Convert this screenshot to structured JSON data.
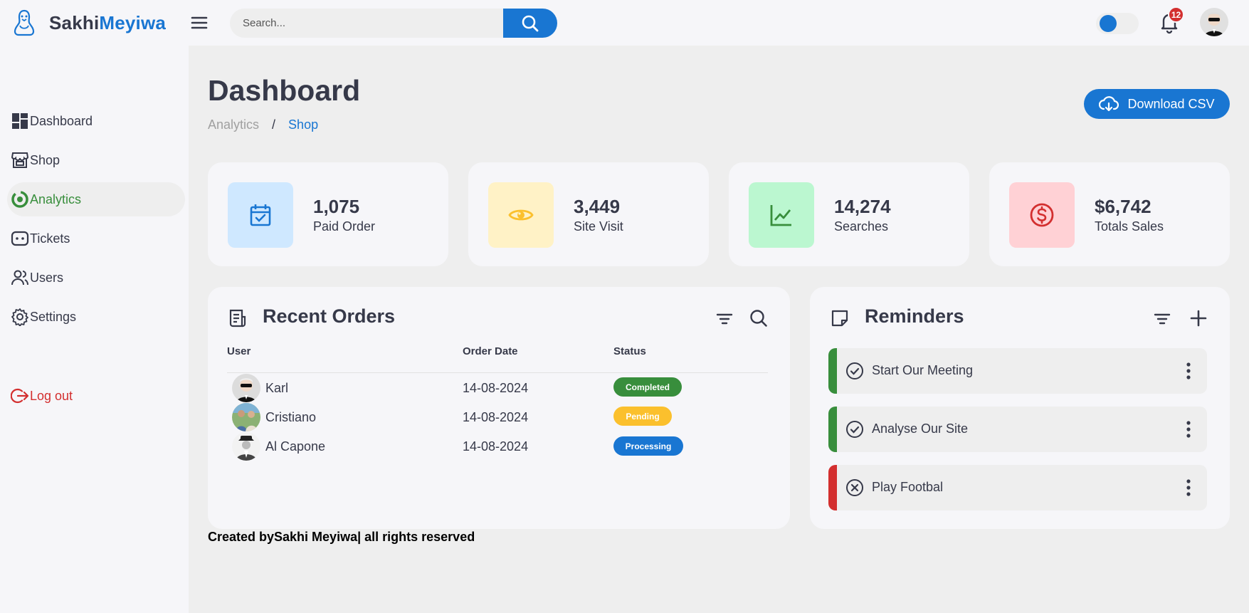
{
  "brand": {
    "part1": "Sakhi",
    "part2": "Meyiwa"
  },
  "search": {
    "placeholder": "Search..."
  },
  "notifications": {
    "count": "12"
  },
  "sidebar": {
    "items": [
      {
        "label": "Dashboard",
        "icon": "dashboard-icon"
      },
      {
        "label": "Shop",
        "icon": "store-icon"
      },
      {
        "label": "Analytics",
        "icon": "analytics-icon",
        "active": true
      },
      {
        "label": "Tickets",
        "icon": "ticket-icon"
      },
      {
        "label": "Users",
        "icon": "users-icon"
      },
      {
        "label": "Settings",
        "icon": "gear-icon"
      }
    ],
    "logout": "Log out"
  },
  "header": {
    "title": "Dashboard",
    "breadcrumb": [
      "Analytics",
      "/",
      "Shop"
    ],
    "download_label": "Download CSV"
  },
  "stats": [
    {
      "value": "1,075",
      "label": "Paid Order",
      "icon": "calendar-check-icon",
      "bg": "#cfe8ff",
      "color": "#1976d2"
    },
    {
      "value": "3,449",
      "label": "Site Visit",
      "icon": "eye-icon",
      "bg": "#fff2c6",
      "color": "#fbc02d"
    },
    {
      "value": "14,274",
      "label": "Searches",
      "icon": "line-chart-icon",
      "bg": "#bbf7d0",
      "color": "#388e3c"
    },
    {
      "value": "$6,742",
      "label": "Totals Sales",
      "icon": "dollar-circle-icon",
      "bg": "#ffd1d5",
      "color": "#d32f2f"
    }
  ],
  "orders": {
    "title": "Recent Orders",
    "columns": [
      "User",
      "Order Date",
      "Status"
    ],
    "rows": [
      {
        "user": "Karl",
        "date": "14-08-2024",
        "status": "Completed",
        "status_color": "#388e3c"
      },
      {
        "user": "Cristiano",
        "date": "14-08-2024",
        "status": "Pending",
        "status_color": "#fbc02d"
      },
      {
        "user": "Al Capone",
        "date": "14-08-2024",
        "status": "Processing",
        "status_color": "#1976d2"
      }
    ]
  },
  "reminders": {
    "title": "Reminders",
    "items": [
      {
        "text": "Start Our Meeting",
        "state": "done",
        "color": "#388e3c"
      },
      {
        "text": "Analyse Our Site",
        "state": "done",
        "color": "#388e3c"
      },
      {
        "text": "Play Footbal",
        "state": "cancelled",
        "color": "#d32f2f"
      }
    ]
  },
  "footer": {
    "credit": "Created bySakhi Meyiwa| all rights reserved"
  },
  "colors": {
    "primary": "#1976d2",
    "success": "#388e3c",
    "warning": "#fbc02d",
    "danger": "#d32f2f",
    "dark": "#363949"
  }
}
